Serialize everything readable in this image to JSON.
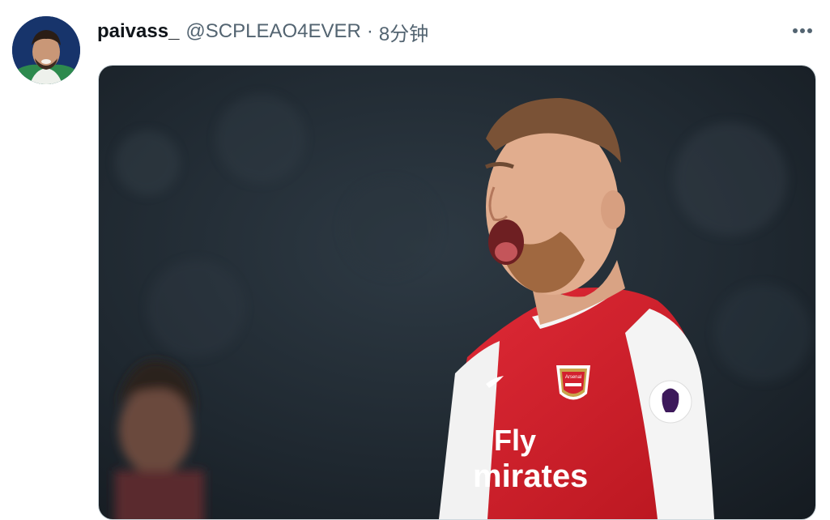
{
  "tweet": {
    "author_name": "paivass_",
    "author_handle": "@SCPLEAO4EVER",
    "separator": "·",
    "timestamp": "8分钟",
    "avatar_icon": "user-avatar",
    "more_icon": "more-horizontal-icon",
    "media": {
      "kind": "photo",
      "shirt_sponsor_line1": "Fly",
      "shirt_sponsor_line2": "mirates",
      "badge_text": "Arsenal"
    }
  },
  "colors": {
    "text_primary": "#0f1419",
    "text_secondary": "#536471",
    "border": "#cfd9de",
    "shirt_red": "#d3202e"
  }
}
